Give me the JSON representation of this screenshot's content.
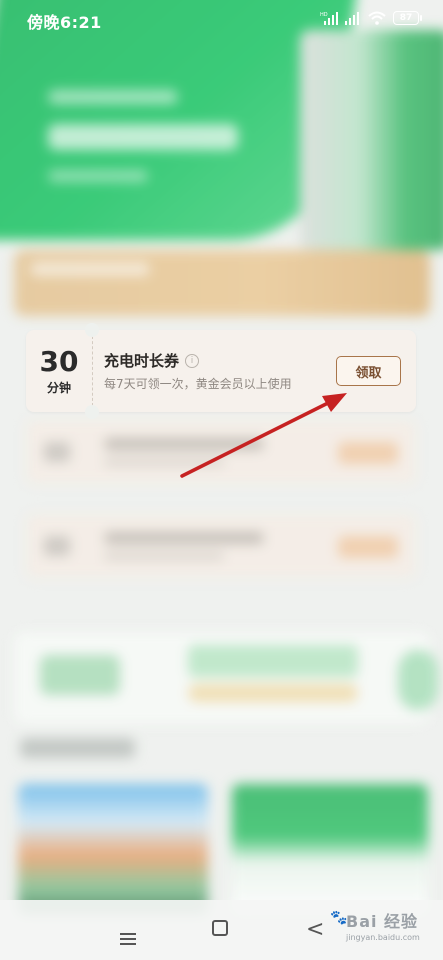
{
  "status_bar": {
    "time": "傍晚6:21",
    "battery": "87",
    "icons": [
      "hd-signal-icon",
      "signal-icon",
      "wifi-icon",
      "battery-icon"
    ]
  },
  "coupon": {
    "amount": "30",
    "unit": "分钟",
    "title": "充电时长券",
    "info_icon": "i",
    "description": "每7天可领一次，黄金会员以上使用",
    "claim_label": "领取"
  },
  "nav": {
    "icons": [
      "menu-icon",
      "home-icon",
      "back-icon"
    ],
    "back_glyph": "<"
  },
  "watermark": {
    "main": "Bai 经验",
    "sub": "jingyan.baidu.com"
  },
  "colors": {
    "brand_green": "#12c25e",
    "claim_border": "#a8754a",
    "arrow_red": "#c62222"
  }
}
